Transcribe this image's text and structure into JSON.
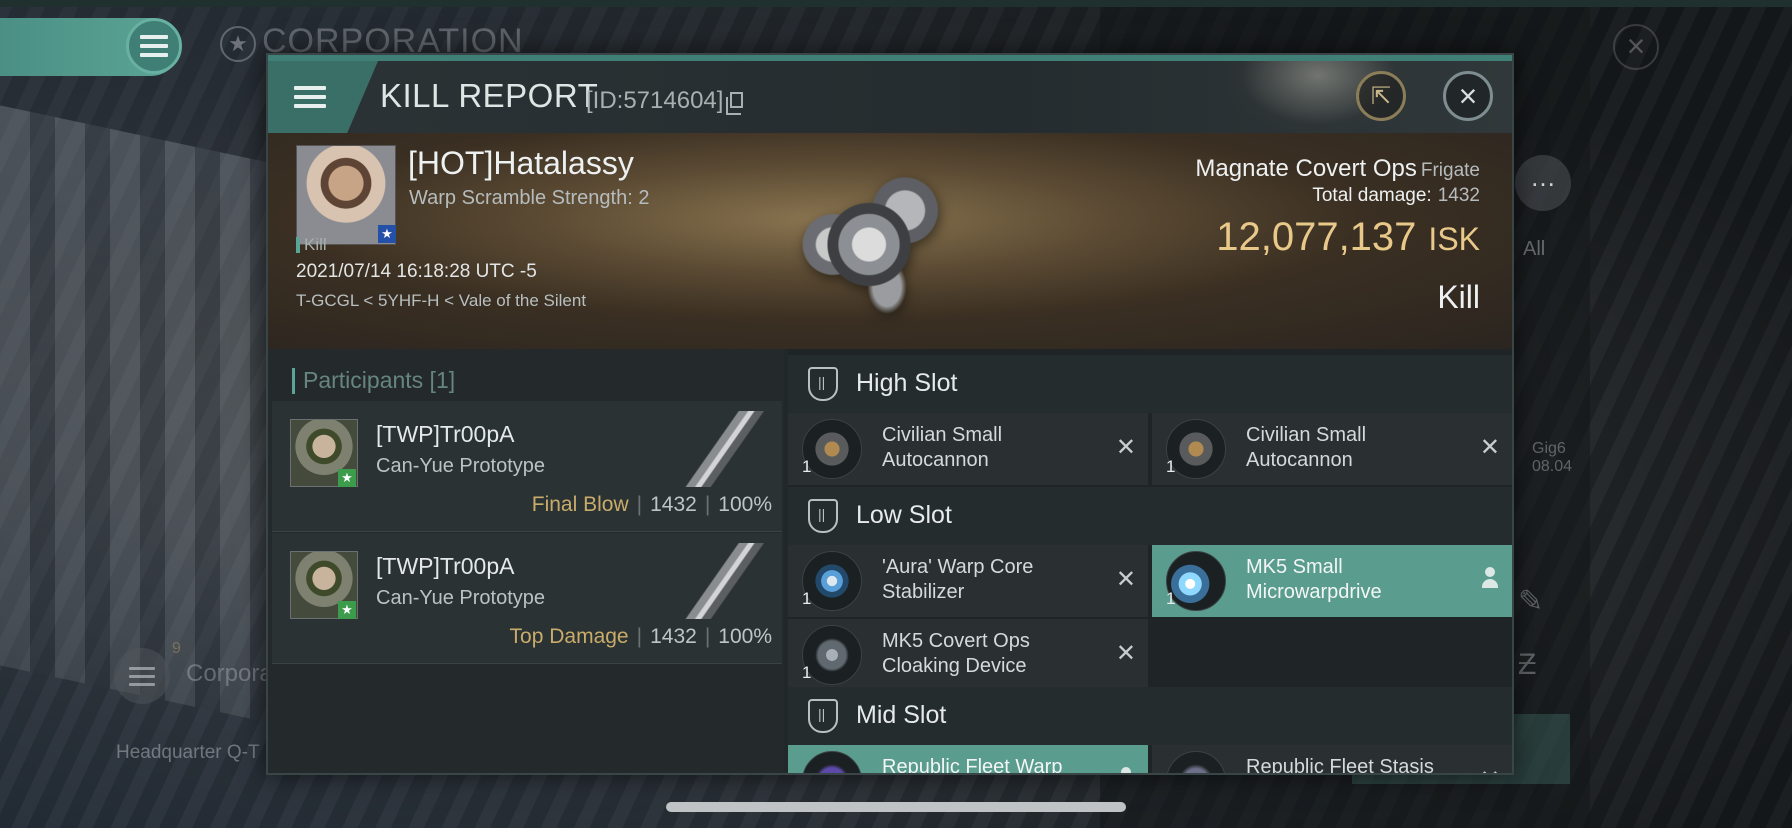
{
  "background": {
    "corp_title": "CORPORATION",
    "corp_label": "Corporati",
    "corp_count": "9",
    "hq_text": "Headquarter Q-T",
    "all_tab": "All",
    "gig_line1": "Gig6",
    "gig_line2": "08.04"
  },
  "header": {
    "title": "KILL REPORT",
    "id_text": "[ID:5714604]"
  },
  "victim": {
    "name": "[HOT]Hatalassy",
    "warp_scramble": "Warp Scramble Strength: 2",
    "kill_tag": "Kill",
    "timestamp": "2021/07/14 16:18:28 UTC -5",
    "location": "T-GCGL < 5YHF-H < Vale of the Silent",
    "ship_name": "Magnate Covert Ops",
    "ship_class": "Frigate",
    "total_damage_label": "Total damage:",
    "total_damage_value": "1432",
    "isk_value": "12,077,137",
    "isk_unit": "ISK",
    "result": "Kill"
  },
  "participants": {
    "heading": "Participants [1]",
    "rows": [
      {
        "name": "[TWP]Tr00pA",
        "ship": "Can-Yue Prototype",
        "label": "Final Blow",
        "damage": "1432",
        "percent": "100%"
      },
      {
        "name": "[TWP]Tr00pA",
        "ship": "Can-Yue Prototype",
        "label": "Top Damage",
        "damage": "1432",
        "percent": "100%"
      }
    ]
  },
  "fitting": {
    "high_slot": {
      "title": "High Slot",
      "modules": [
        {
          "qty": "1",
          "name": "Civilian Small Autocannon",
          "status": "destroyed",
          "icon": "autocannon-icon"
        },
        {
          "qty": "1",
          "name": "Civilian Small Autocannon",
          "status": "destroyed",
          "icon": "autocannon-icon"
        }
      ]
    },
    "low_slot": {
      "title": "Low Slot",
      "modules": [
        {
          "qty": "1",
          "name": "'Aura' Warp Core Stabilizer",
          "status": "destroyed",
          "icon": "warp-core-stabilizer-icon"
        },
        {
          "qty": "1",
          "name": "MK5 Small Microwarpdrive",
          "status": "dropped",
          "icon": "microwarpdrive-icon"
        },
        {
          "qty": "1",
          "name": "MK5 Covert Ops Cloaking Device",
          "status": "destroyed",
          "icon": "cloaking-device-icon"
        }
      ]
    },
    "mid_slot": {
      "title": "Mid Slot",
      "modules": [
        {
          "qty": "",
          "name": "Republic Fleet Warp",
          "status": "dropped",
          "icon": "warp-disruptor-icon"
        },
        {
          "qty": "",
          "name": "Republic Fleet Stasis",
          "status": "destroyed",
          "icon": "stasis-webifier-icon"
        }
      ]
    }
  },
  "colors": {
    "accent_teal": "#5ba596",
    "isk_gold": "#e9c98a",
    "final_blow_gold": "#c9ac6a"
  }
}
